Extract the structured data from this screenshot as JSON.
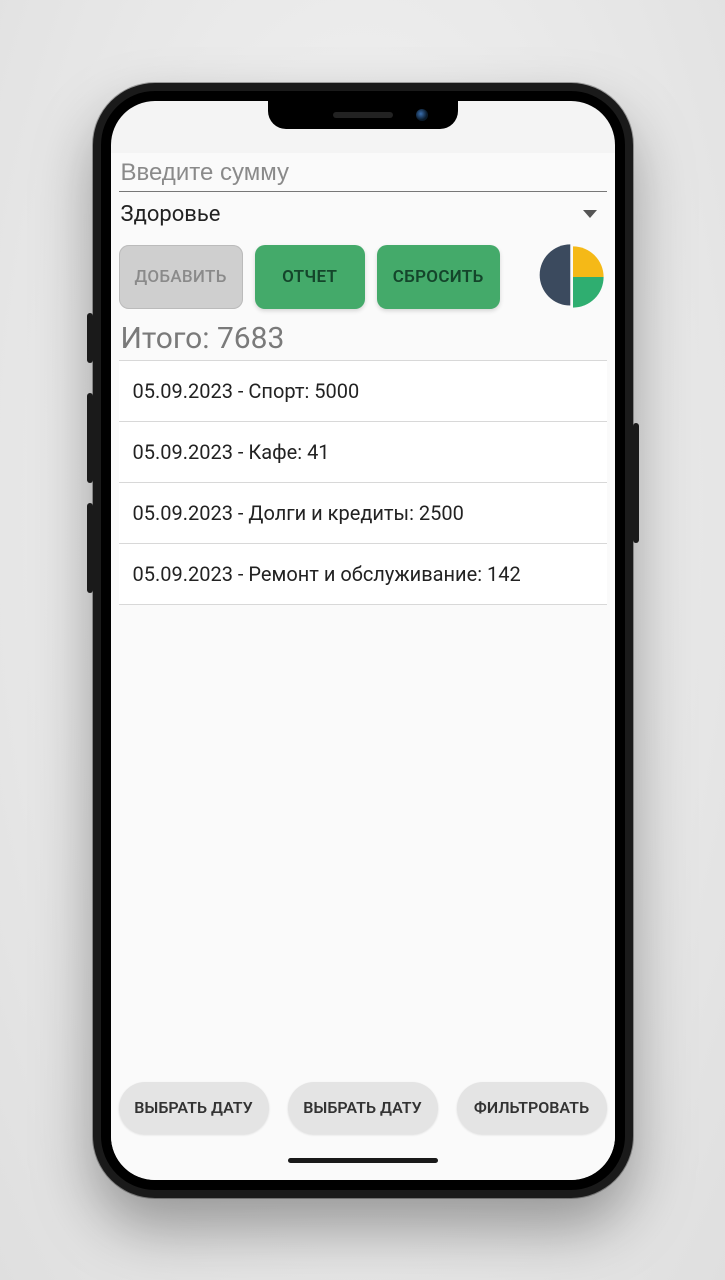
{
  "input": {
    "placeholder": "Введите сумму"
  },
  "dropdown": {
    "selected": "Здоровье"
  },
  "buttons": {
    "add": "ДОБАВИТЬ",
    "report": "ОТЧЕТ",
    "reset": "СБРОСИТЬ"
  },
  "total": {
    "label_with_value": "Итого: 7683"
  },
  "entries": [
    {
      "text": "05.09.2023 - Спорт: 5000"
    },
    {
      "text": "05.09.2023 - Кафе: 41"
    },
    {
      "text": "05.09.2023 - Долги и кредиты: 2500"
    },
    {
      "text": "05.09.2023 - Ремонт и обслуживание: 142"
    }
  ],
  "bottom": {
    "date1": "ВЫБРАТЬ ДАТУ",
    "date2": "ВЫБРАТЬ ДАТУ",
    "filter": "ФИЛЬТРОВАТЬ"
  },
  "chart_data": {
    "type": "pie",
    "title": "",
    "series": [
      {
        "name": "segment-1",
        "value": 50,
        "color": "#3b4a5e"
      },
      {
        "name": "segment-2",
        "value": 25,
        "color": "#f5b917"
      },
      {
        "name": "segment-3",
        "value": 25,
        "color": "#2fae70"
      }
    ]
  }
}
